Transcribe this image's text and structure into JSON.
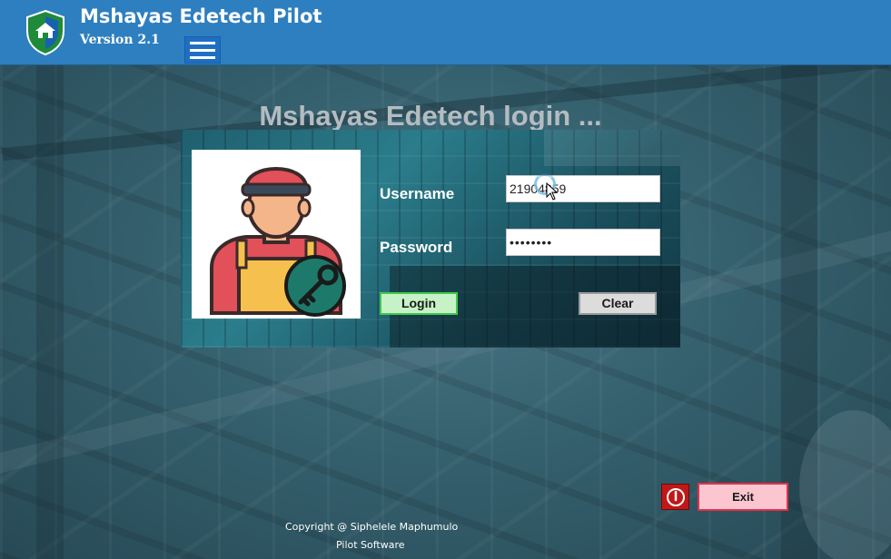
{
  "header": {
    "title": "Mshayas Edetech Pilot",
    "version": "Version 2.1",
    "logo_icon": "shield-house-icon",
    "menu_icon": "hamburger-menu-icon"
  },
  "login": {
    "heading": "Mshayas Edetech login ...",
    "username_label": "Username",
    "username_value": "21904859",
    "password_label": "Password",
    "password_value": "••••••••",
    "login_button": "Login",
    "clear_button": "Clear",
    "avatar_icon": "worker-with-key-icon"
  },
  "exit": {
    "power_icon": "power-icon",
    "exit_button": "Exit"
  },
  "footer": {
    "copyright": "Copyright @ Siphelele Maphumulo",
    "product": "Pilot Software"
  },
  "colors": {
    "header_bg": "#2e7fc0",
    "login_green": "#3fc94a",
    "exit_red": "#e23049",
    "power_red": "#c01818"
  }
}
